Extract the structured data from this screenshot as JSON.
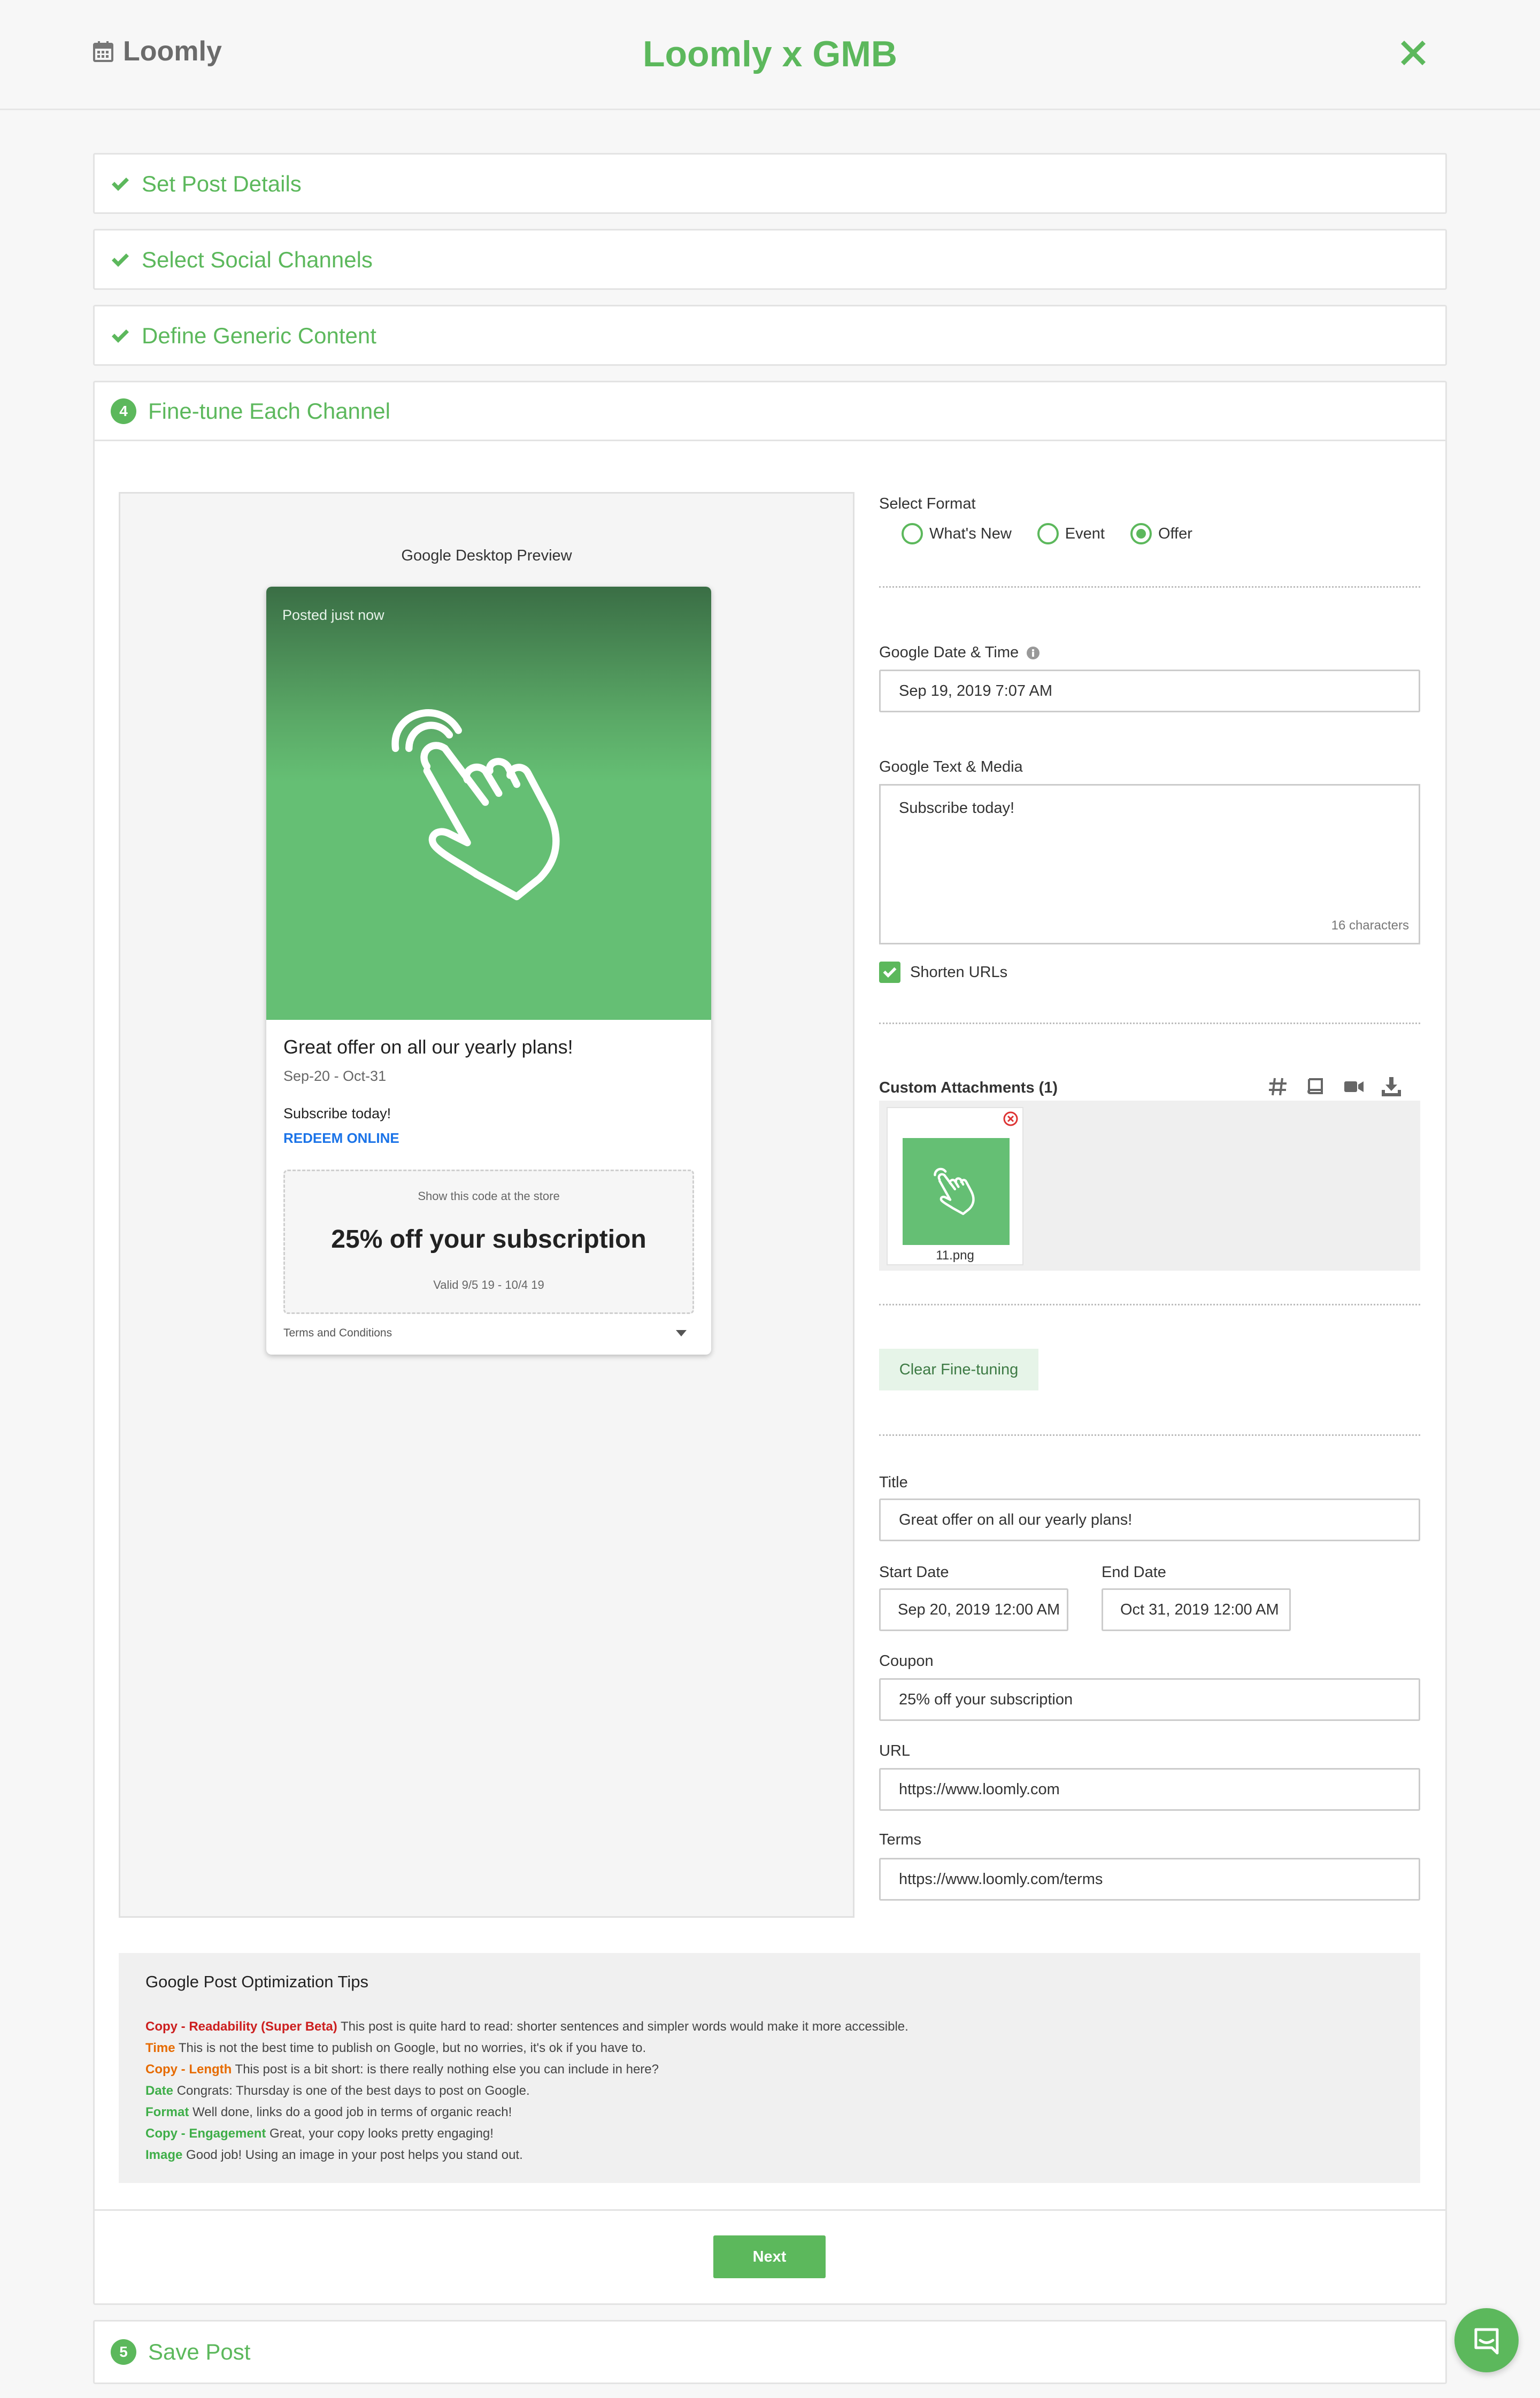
{
  "header": {
    "brand": "Loomly",
    "title": "Loomly x GMB"
  },
  "colors": {
    "accent": "#5cb85c",
    "red": "#cc1f1f",
    "orange": "#e66b00",
    "green": "#3fae49",
    "link": "#1a73e8"
  },
  "steps": [
    {
      "label": "Set Post Details",
      "state": "done"
    },
    {
      "label": "Select Social Channels",
      "state": "done"
    },
    {
      "label": "Define Generic Content",
      "state": "done"
    },
    {
      "label": "Fine-tune Each Channel",
      "number": "4",
      "state": "active"
    },
    {
      "label": "Save Post",
      "number": "5",
      "state": "pending"
    }
  ],
  "preview": {
    "title": "Google Desktop Preview",
    "posted": "Posted just now",
    "card_title": "Great offer on all our yearly plans!",
    "card_dates": "Sep-20 - Oct-31",
    "card_text": "Subscribe today!",
    "redeem": "REDEEM ONLINE",
    "coupon_hint": "Show this code at the store",
    "coupon_code": "25% off your subscription",
    "coupon_valid": "Valid 9/5 19 - 10/4 19",
    "terms_link": "Terms and Conditions"
  },
  "form": {
    "format_label": "Select Format",
    "formats": [
      {
        "label": "What's New",
        "selected": false
      },
      {
        "label": "Event",
        "selected": false
      },
      {
        "label": "Offer",
        "selected": true
      }
    ],
    "datetime_label": "Google Date & Time",
    "datetime_value": "Sep 19, 2019 7:07 AM",
    "text_label": "Google Text & Media",
    "text_value": "Subscribe today!",
    "char_count": "16 characters",
    "shorten_label": "Shorten URLs",
    "attachments_label": "Custom Attachments (1)",
    "attachment_name": "11.png",
    "clear_button": "Clear Fine-tuning",
    "title_label": "Title",
    "title_value": "Great offer on all our yearly plans!",
    "start_label": "Start Date",
    "start_value": "Sep 20, 2019 12:00 AM",
    "end_label": "End Date",
    "end_value": "Oct 31, 2019 12:00 AM",
    "coupon_label": "Coupon",
    "coupon_value": "25% off your subscription",
    "url_label": "URL",
    "url_value": "https://www.loomly.com",
    "terms_label": "Terms",
    "terms_value": "https://www.loomly.com/terms"
  },
  "tips": {
    "title": "Google Post Optimization Tips",
    "items": [
      {
        "key": "Copy - Readability (Super Beta)",
        "text": "This post is quite hard to read: shorter sentences and simpler words would make it more accessible.",
        "color": "#cc1f1f"
      },
      {
        "key": "Time",
        "text": "This is not the best time to publish on Google, but no worries, it's ok if you have to.",
        "color": "#e66b00"
      },
      {
        "key": "Copy - Length",
        "text": "This post is a bit short: is there really nothing else you can include in here?",
        "color": "#e66b00"
      },
      {
        "key": "Date",
        "text": "Congrats: Thursday is one of the best days to post on Google.",
        "color": "#3fae49"
      },
      {
        "key": "Format",
        "text": "Well done, links do a good job in terms of organic reach!",
        "color": "#3fae49"
      },
      {
        "key": "Copy - Engagement",
        "text": "Great, your copy looks pretty engaging!",
        "color": "#3fae49"
      },
      {
        "key": "Image",
        "text": "Good job! Using an image in your post helps you stand out.",
        "color": "#3fae49"
      }
    ]
  },
  "next_button": "Next",
  "icons": [
    "calendar-icon",
    "close-icon",
    "check-icon",
    "info-icon",
    "hashtag-icon",
    "book-icon",
    "video-icon",
    "download-icon",
    "hand-pointer-icon",
    "remove-icon",
    "chat-icon"
  ]
}
